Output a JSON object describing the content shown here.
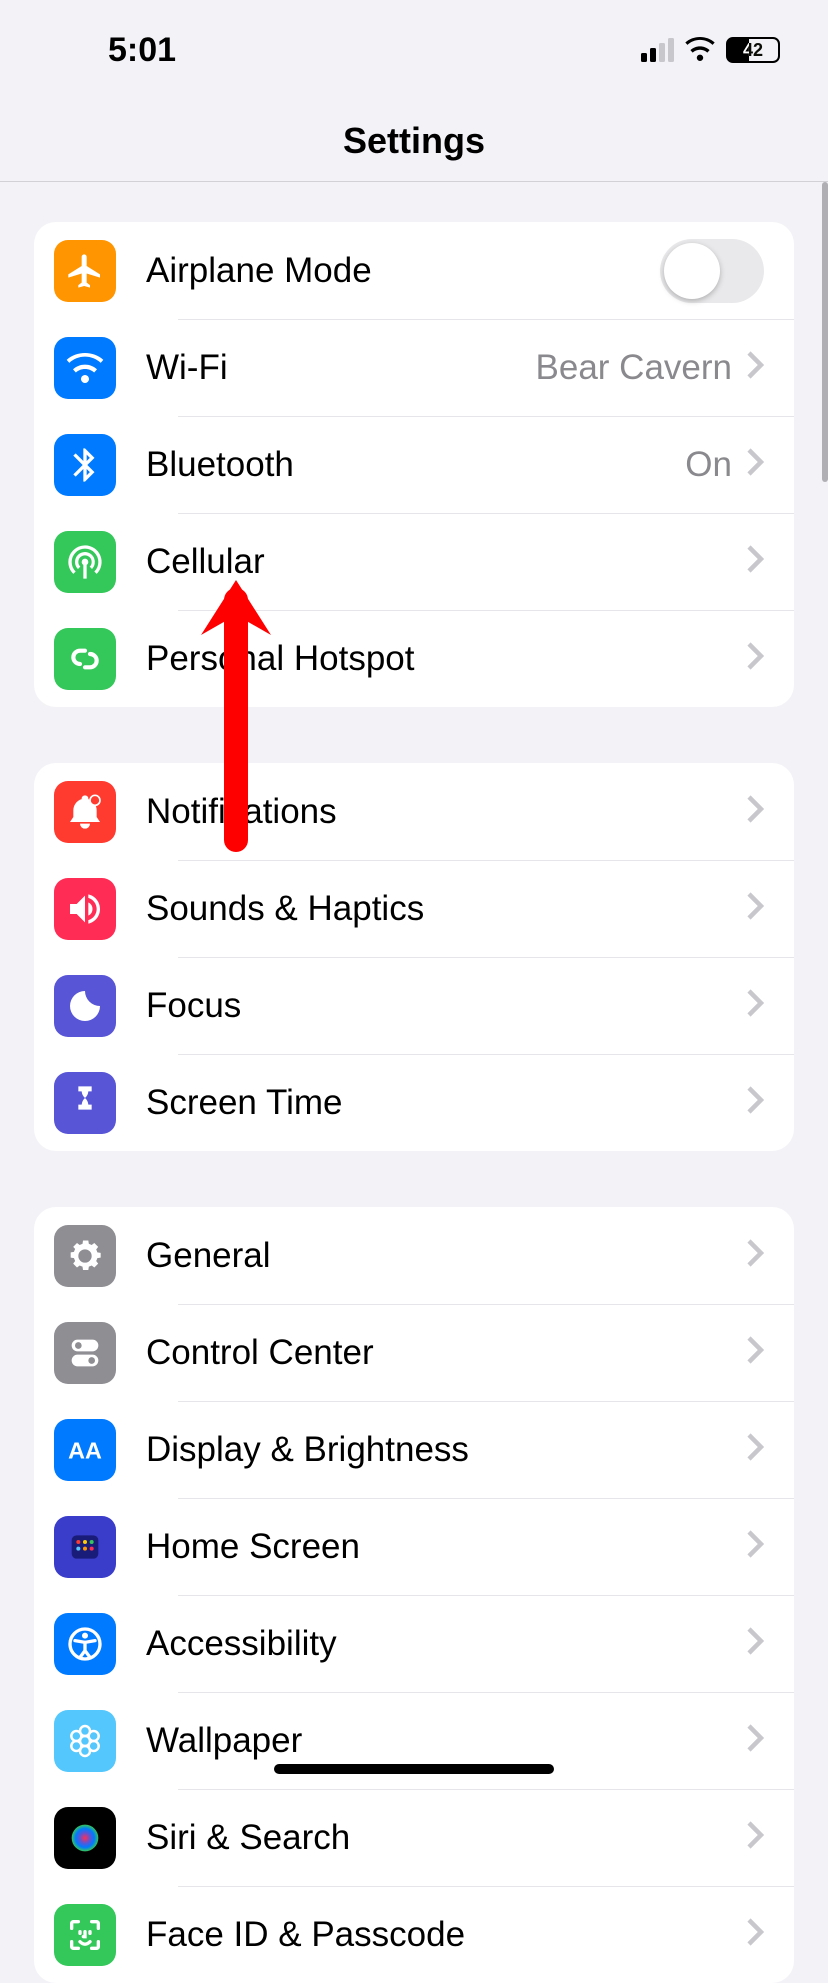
{
  "status": {
    "time": "5:01",
    "battery": "42"
  },
  "header": {
    "title": "Settings"
  },
  "g1": {
    "airplane": "Airplane Mode",
    "wifi": "Wi-Fi",
    "wifi_value": "Bear Cavern",
    "bluetooth": "Bluetooth",
    "bluetooth_value": "On",
    "cellular": "Cellular",
    "hotspot": "Personal Hotspot"
  },
  "g2": {
    "notifications": "Notifications",
    "sounds": "Sounds & Haptics",
    "focus": "Focus",
    "screentime": "Screen Time"
  },
  "g3": {
    "general": "General",
    "controlcenter": "Control Center",
    "display": "Display & Brightness",
    "homescreen": "Home Screen",
    "accessibility": "Accessibility",
    "wallpaper": "Wallpaper",
    "siri": "Siri & Search",
    "faceid": "Face ID & Passcode"
  }
}
